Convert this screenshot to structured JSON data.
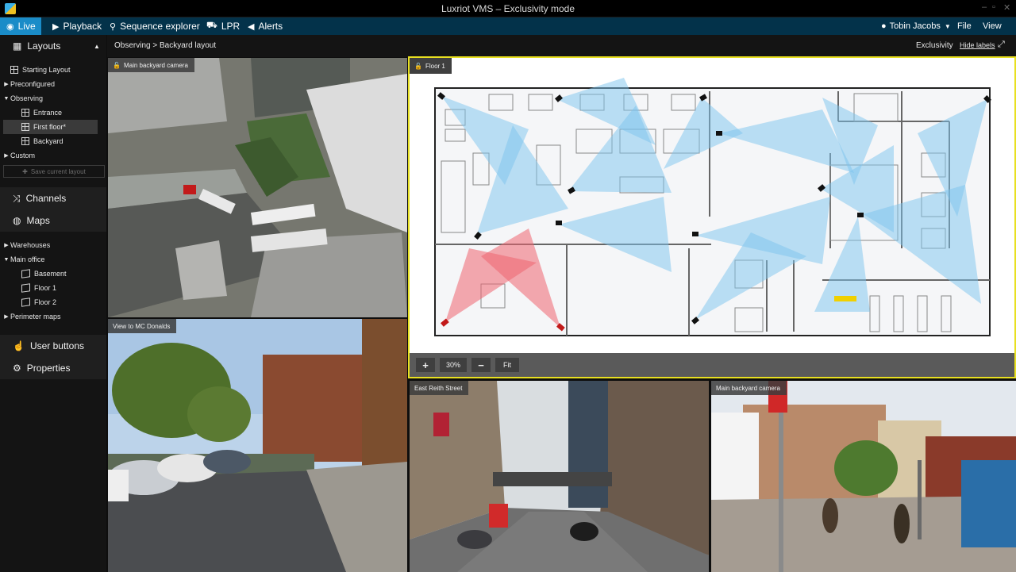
{
  "window": {
    "title": "Luxriot VMS – Exclusivity mode",
    "min": "–",
    "max": "▫",
    "close": "✕"
  },
  "menubar": {
    "tabs": [
      {
        "label": "Live",
        "icon": "eye-icon"
      },
      {
        "label": "Playback",
        "icon": "play-icon"
      },
      {
        "label": "Sequence explorer",
        "icon": "binoculars-icon"
      },
      {
        "label": "LPR",
        "icon": "car-icon"
      },
      {
        "label": "Alerts",
        "icon": "megaphone-icon"
      }
    ],
    "user": "Tobin Jacobs",
    "file": "File",
    "view": "View"
  },
  "sidebar": {
    "layouts_label": "Layouts",
    "layout_items": [
      {
        "label": "Starting Layout"
      },
      {
        "label": "Preconfigured"
      },
      {
        "label": "Observing"
      },
      {
        "label": "Entrance"
      },
      {
        "label": "First floor*"
      },
      {
        "label": "Backyard"
      },
      {
        "label": "Custom"
      }
    ],
    "save_layout": "Save current layout",
    "channels_label": "Channels",
    "maps_label": "Maps",
    "map_items": [
      {
        "label": "Warehouses"
      },
      {
        "label": "Main office"
      },
      {
        "label": "Basement"
      },
      {
        "label": "Floor 1"
      },
      {
        "label": "Floor 2"
      },
      {
        "label": "Perimeter maps"
      }
    ],
    "user_buttons_label": "User buttons",
    "properties_label": "Properties"
  },
  "breadcrumb": {
    "text": "Observing > Backyard layout",
    "exclusivity": "Exclusivity",
    "hide_labels": "Hide labels"
  },
  "tiles": {
    "cam1": "Main backyard camera",
    "cam2": "View to MC Donalds",
    "map": "Floor 1",
    "cam3": "East Reith Street",
    "cam4": "Main backyard camera"
  },
  "map_controls": {
    "zoom_in": "+",
    "zoom": "30%",
    "zoom_out": "−",
    "fit": "Fit"
  },
  "colors": {
    "accent": "#1a8cc8",
    "menubar": "#03324a",
    "selection": "#e8e020",
    "camera_cone_blue": "#7cc4ee",
    "camera_cone_red": "#ee6470"
  }
}
